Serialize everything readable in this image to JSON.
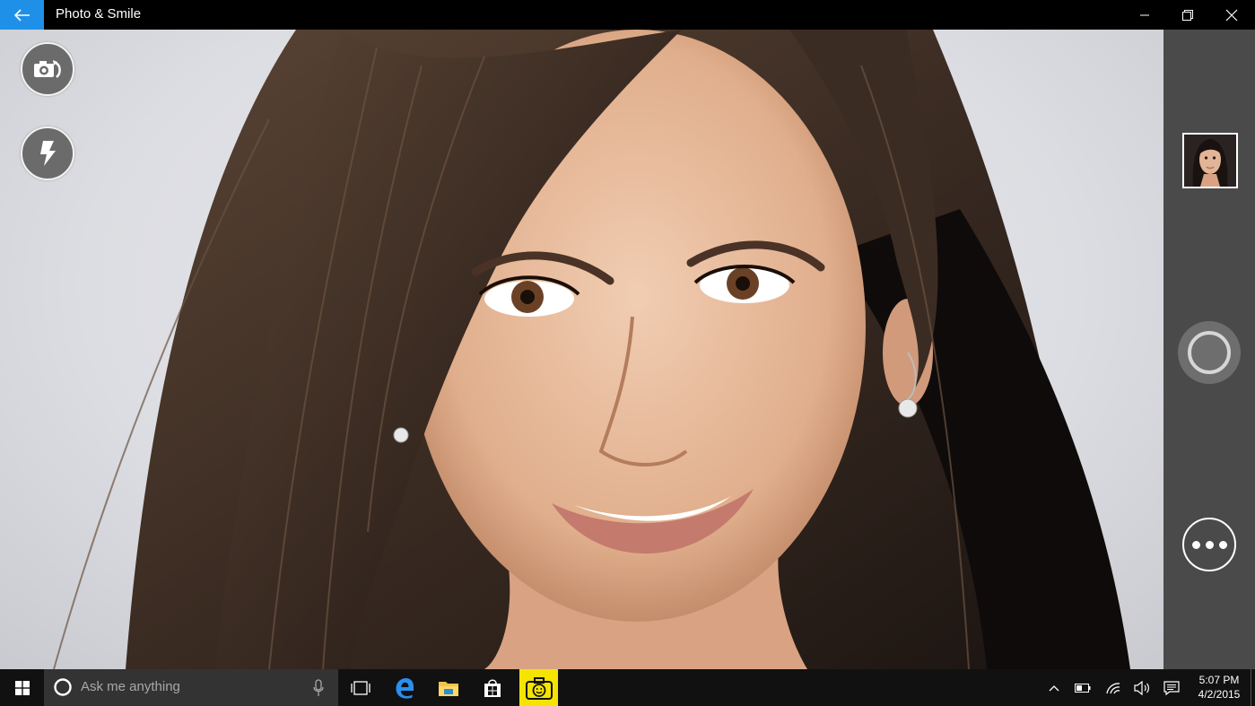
{
  "window": {
    "title": "Photo & Smile"
  },
  "taskbar": {
    "search_placeholder": "Ask me anything",
    "time": "5:07 PM",
    "date": "4/2/2015"
  },
  "colors": {
    "accent": "#1e90e8",
    "pinned_app_highlight": "#f5e400"
  },
  "icons": {
    "back": "back-arrow-icon",
    "minimize": "minimize-icon",
    "restore": "restore-icon",
    "close": "close-icon",
    "switch_camera": "switch-camera-icon",
    "flash": "flash-icon",
    "shutter": "shutter-icon",
    "more": "more-icon",
    "start": "windows-start-icon",
    "cortana": "cortana-icon",
    "microphone": "microphone-icon",
    "task_view": "task-view-icon",
    "edge": "edge-icon",
    "file_explorer": "file-explorer-icon",
    "store": "store-icon",
    "photo_smile_app": "photo-smile-app-icon",
    "tray_chevron": "chevron-up-icon",
    "battery": "battery-icon",
    "wifi": "wifi-icon",
    "volume": "volume-icon",
    "action_center": "action-center-icon"
  }
}
